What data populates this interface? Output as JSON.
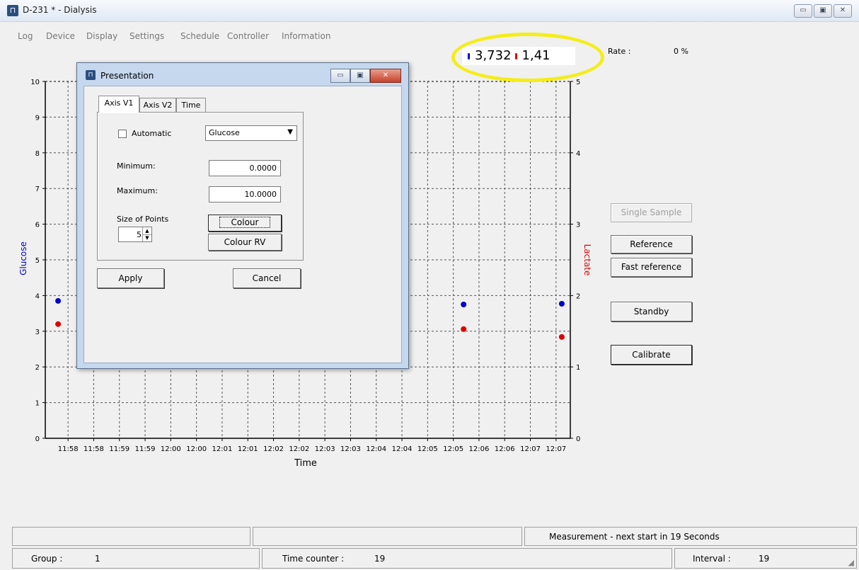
{
  "window": {
    "title": "D-231 * - Dialysis",
    "controls": [
      "▭",
      "▣",
      "✕"
    ]
  },
  "menu": [
    "Log",
    "Device",
    "Display",
    "Settings",
    "Schedule",
    "Controller",
    "Information"
  ],
  "readout": {
    "glucose": "3,732",
    "lactate": "1,41",
    "glucose_color": "#0000cc",
    "lactate_color": "#dd0000"
  },
  "rate": {
    "label": "Rate :",
    "value": "0 %"
  },
  "buttons": {
    "single_sample": "Single Sample",
    "reference": "Reference",
    "fast_reference": "Fast reference",
    "standby": "Standby",
    "calibrate": "Calibrate"
  },
  "chart_data": {
    "type": "scatter",
    "xlabel": "Time",
    "ylabel_left": "Glucose",
    "ylabel_right": "Lactate",
    "x_ticks": [
      "11:58",
      "11:58",
      "11:59",
      "11:59",
      "12:00",
      "12:00",
      "12:01",
      "12:01",
      "12:02",
      "12:02",
      "12:03",
      "12:03",
      "12:04",
      "12:04",
      "12:05",
      "12:05",
      "12:06",
      "12:06",
      "12:07",
      "12:07"
    ],
    "y_left_ticks": [
      "0",
      "1",
      "2",
      "3",
      "4",
      "5",
      "6",
      "7",
      "8",
      "9",
      "10"
    ],
    "y_right_ticks": [
      "0",
      "1",
      "2",
      "3",
      "4",
      "5"
    ],
    "ylim_left": [
      0,
      10
    ],
    "ylim_right": [
      0,
      5
    ],
    "grid": true,
    "series": [
      {
        "name": "Glucose",
        "axis": "left",
        "color": "#0000cc",
        "x": [
          "11:57:45",
          "12:05:40",
          "12:07:35"
        ],
        "y": [
          3.85,
          3.75,
          3.77
        ]
      },
      {
        "name": "Lactate",
        "axis": "right",
        "color": "#dd0000",
        "x": [
          "11:57:45",
          "12:05:40",
          "12:07:35"
        ],
        "y": [
          1.6,
          1.53,
          1.42
        ]
      }
    ]
  },
  "dialog": {
    "title": "Presentation",
    "tabs": [
      "Axis V1",
      "Axis V2",
      "Time"
    ],
    "automatic_label": "Automatic",
    "channel_value": "Glucose",
    "minimum_label": "Minimum:",
    "minimum_value": "0.0000",
    "maximum_label": "Maximum:",
    "maximum_value": "10.0000",
    "size_label": "Size of Points",
    "size_value": "5",
    "colour_button": "Colour",
    "colour_rv_button": "Colour RV",
    "apply_button": "Apply",
    "cancel_button": "Cancel"
  },
  "status": {
    "measurement": "Measurement - next start in  19 Seconds",
    "group_label": "Group :",
    "group_value": "1",
    "time_counter_label": "Time counter :",
    "time_counter_value": "19",
    "interval_label": "Interval :",
    "interval_value": "19"
  }
}
